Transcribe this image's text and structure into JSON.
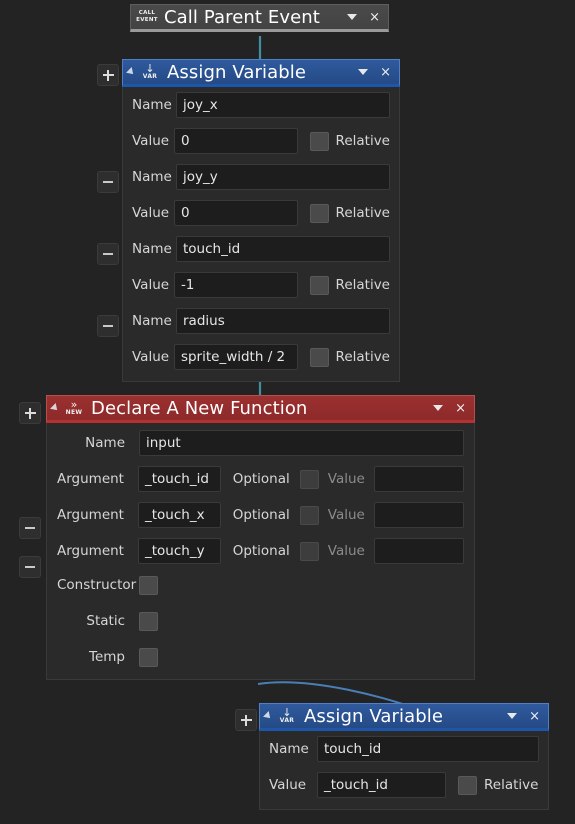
{
  "app": {
    "name": "visual-script-graph-editor",
    "canvas_background": "#232323"
  },
  "colors": {
    "node_blue": "#2f5a9e",
    "node_red": "#9c3030",
    "node_grey": "#4a4a4a",
    "wire_teal": "#3f8fa0",
    "wire_blue": "#4a7fb5",
    "field_background": "#1d1d1d",
    "text": "#e0e0e0"
  },
  "nodes": {
    "call_parent_event": {
      "title": "Call Parent Event",
      "badge_line1": "CALL",
      "badge_line2": "EVENT",
      "caret": "▼",
      "close": "×"
    },
    "assign_variable_top": {
      "title": "Assign Variable",
      "badge_glyph": "↓",
      "badge_sub": "VAR",
      "caret": "▼",
      "close": "×",
      "add_button": "+",
      "remove_button": "−",
      "relative_label": "Relative",
      "entries": [
        {
          "name_label": "Name",
          "name_value": "joy_x",
          "value_label": "Value",
          "value": "0",
          "relative": false
        },
        {
          "name_label": "Name",
          "name_value": "joy_y",
          "value_label": "Value",
          "value": "0",
          "relative": false
        },
        {
          "name_label": "Name",
          "name_value": "touch_id",
          "value_label": "Value",
          "value": "-1",
          "relative": false
        },
        {
          "name_label": "Name",
          "name_value": "radius",
          "value_label": "Value",
          "value": "sprite_width / 2",
          "relative": false
        }
      ]
    },
    "declare_function": {
      "title": "Declare A New Function",
      "badge_glyph": "»",
      "badge_sub": "NEW",
      "caret": "▼",
      "close": "×",
      "add_button": "+",
      "remove_button": "−",
      "name_label": "Name",
      "name_value": "input",
      "argument_label": "Argument",
      "optional_label": "Optional",
      "value_label": "Value",
      "arguments": [
        {
          "name": "_touch_id",
          "optional": false,
          "value": ""
        },
        {
          "name": "_touch_x",
          "optional": false,
          "value": ""
        },
        {
          "name": "_touch_y",
          "optional": false,
          "value": ""
        }
      ],
      "flags": [
        {
          "label": "Constructor",
          "checked": false
        },
        {
          "label": "Static",
          "checked": false
        },
        {
          "label": "Temp",
          "checked": false
        }
      ]
    },
    "assign_variable_bottom": {
      "title": "Assign Variable",
      "badge_glyph": "↓",
      "badge_sub": "VAR",
      "caret": "▼",
      "close": "×",
      "add_button": "+",
      "relative_label": "Relative",
      "entries": [
        {
          "name_label": "Name",
          "name_value": "touch_id",
          "value_label": "Value",
          "value": "_touch_id",
          "relative": false
        }
      ]
    }
  }
}
